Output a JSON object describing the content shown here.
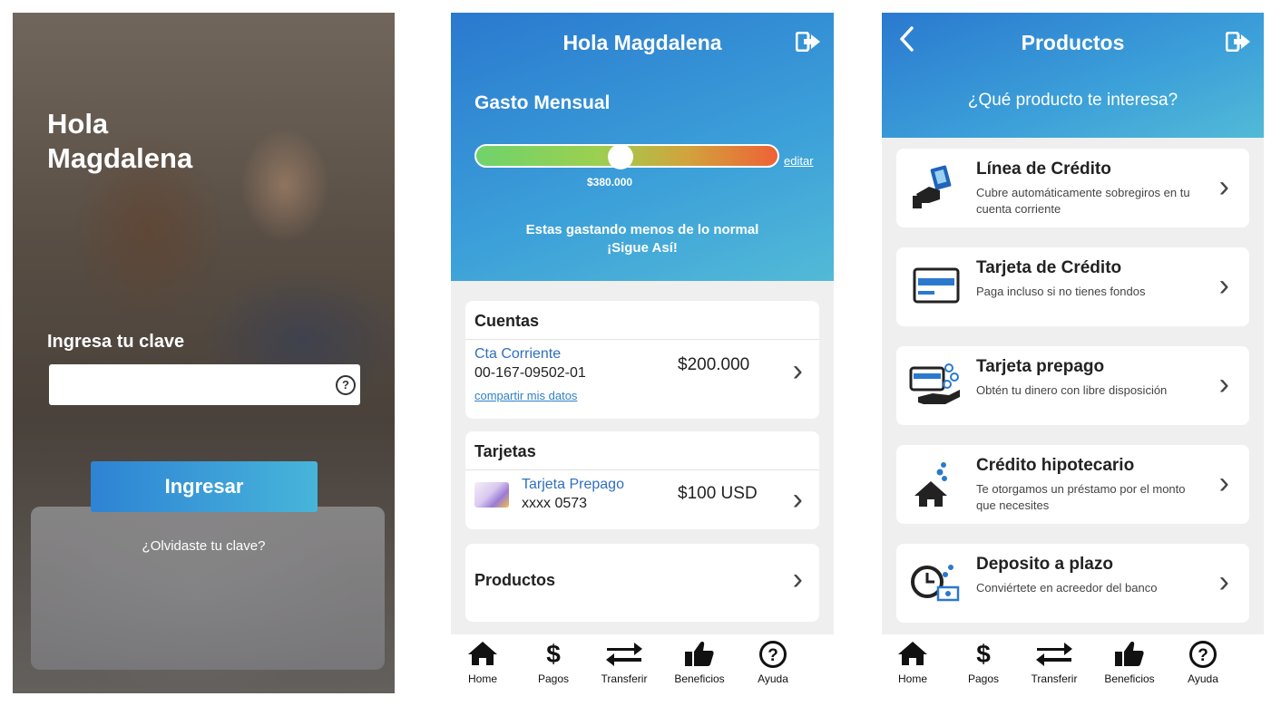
{
  "login": {
    "greeting": "Hola\nMagdalena",
    "password_label": "Ingresa tu clave",
    "password_value": "",
    "help_icon": "question-circle-icon",
    "login_button": "Ingresar",
    "forgot_link": "¿Olvidaste tu clave?"
  },
  "home": {
    "title": "Hola Magdalena",
    "logout_icon": "logout-icon",
    "spend_title": "Gasto Mensual",
    "spend_level": 0.48,
    "spend_amount": "$380.000",
    "edit_link": "editar",
    "message_line1": "Estas gastando menos de lo normal",
    "message_line2": "¡Sigue Así!",
    "accounts": {
      "title": "Cuentas",
      "name": "Cta Corriente",
      "number": "00-167-09502-01",
      "share_link": "compartir mis datos",
      "balance": "$200.000"
    },
    "cards": {
      "title": "Tarjetas",
      "name": "Tarjeta Prepago",
      "number": "xxxx 0573",
      "balance": "$100 USD"
    },
    "products_label": "Productos"
  },
  "products": {
    "title": "Productos",
    "back_icon": "chevron-left-icon",
    "logout_icon": "logout-icon",
    "question": "¿Qué producto te interesa?",
    "items": [
      {
        "title": "Línea de Crédito",
        "desc": "Cubre automáticamente sobregiros en tu cuenta corriente",
        "icon": "money-hand-icon"
      },
      {
        "title": "Tarjeta de Crédito",
        "desc": "Paga incluso si no tienes fondos",
        "icon": "credit-card-icon"
      },
      {
        "title": "Tarjeta prepago",
        "desc": "Obtén tu dinero con libre disposición",
        "icon": "prepaid-card-icon"
      },
      {
        "title": "Crédito hipotecario",
        "desc": "Te otorgamos un préstamo por el monto que necesites",
        "icon": "house-icon"
      },
      {
        "title": "Deposito a plazo",
        "desc": "Conviértete en acreedor del banco",
        "icon": "clock-money-icon"
      }
    ]
  },
  "nav": [
    {
      "label": "Home",
      "icon": "home-icon"
    },
    {
      "label": "Pagos",
      "icon": "dollar-icon"
    },
    {
      "label": "Transferir",
      "icon": "transfer-arrows-icon"
    },
    {
      "label": "Beneficios",
      "icon": "thumbs-up-icon"
    },
    {
      "label": "Ayuda",
      "icon": "question-circle-icon"
    }
  ],
  "colors": {
    "header_start": "#2a79cf",
    "header_end": "#52bad7",
    "link_blue": "#2f6fbf",
    "bar_green": "#6fd36b",
    "bar_orange": "#ee6236"
  }
}
